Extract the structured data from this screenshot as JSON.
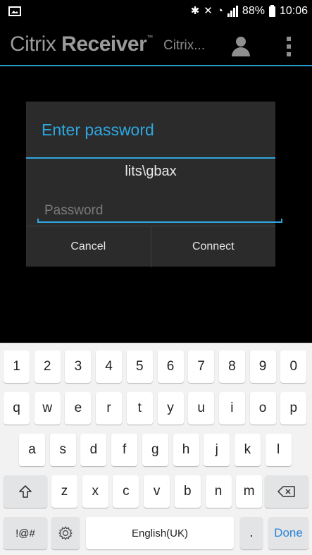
{
  "status_bar": {
    "battery": "88%",
    "time": "10:06",
    "icons": [
      "gallery-icon",
      "bluetooth-icon",
      "mute-icon",
      "wifi-icon",
      "signal-icon",
      "battery-icon"
    ]
  },
  "app_bar": {
    "brand_light": "Citrix",
    "brand_bold": "Receiver",
    "brand_tm": "™",
    "store_name": "Citrix...",
    "icons": [
      "account-icon",
      "overflow-menu-icon"
    ]
  },
  "dialog": {
    "title": "Enter password",
    "username": "lits\\gbax",
    "password_placeholder": "Password",
    "password_value": "",
    "cancel_label": "Cancel",
    "connect_label": "Connect"
  },
  "keyboard": {
    "numbers": [
      "1",
      "2",
      "3",
      "4",
      "5",
      "6",
      "7",
      "8",
      "9",
      "0"
    ],
    "row1": [
      "q",
      "w",
      "e",
      "r",
      "t",
      "y",
      "u",
      "i",
      "o",
      "p"
    ],
    "row2": [
      "a",
      "s",
      "d",
      "f",
      "g",
      "h",
      "j",
      "k",
      "l"
    ],
    "row3": [
      "z",
      "x",
      "c",
      "v",
      "b",
      "n",
      "m"
    ],
    "symbols_label": "!@#",
    "language_label": "English(UK)",
    "period_label": ".",
    "done_label": "Done",
    "icons": [
      "shift-icon",
      "backspace-icon",
      "settings-icon"
    ]
  },
  "colors": {
    "accent": "#2ea7e0",
    "dialog_bg": "#2b2b2b",
    "keyboard_bg": "#f2f2f2",
    "done_text": "#2d84d8"
  }
}
